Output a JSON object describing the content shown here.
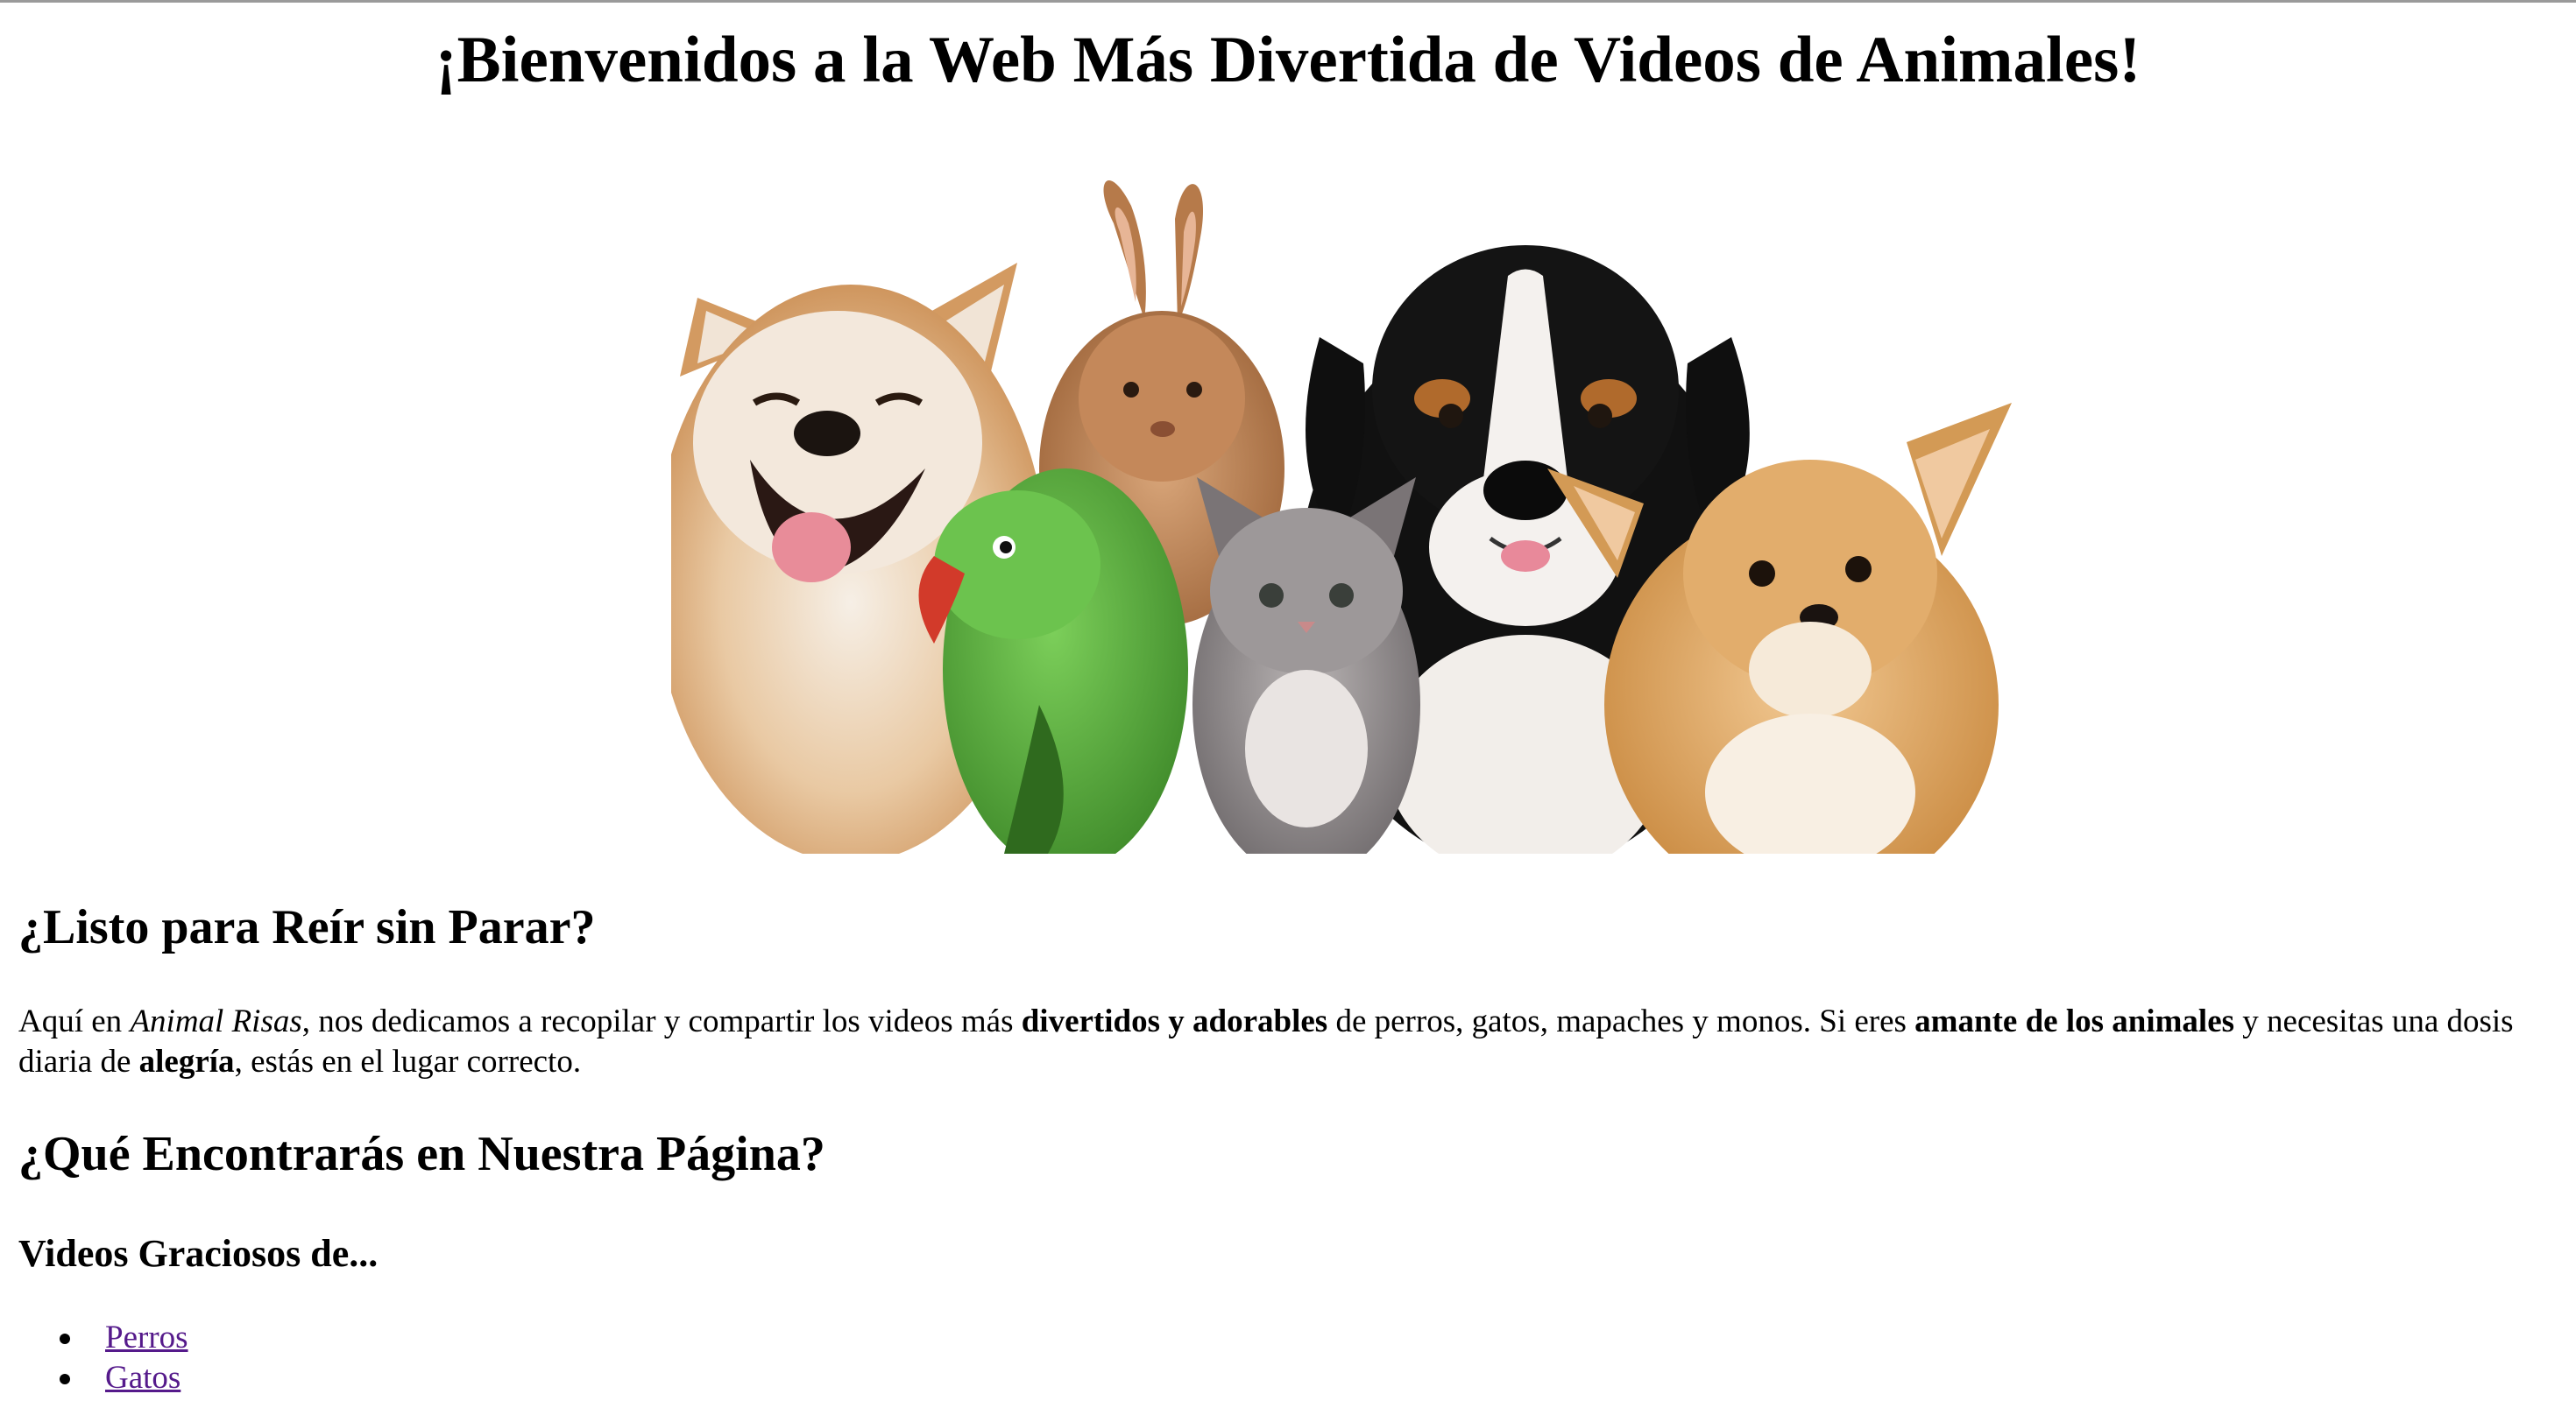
{
  "page": {
    "title": "¡Bienvenidos a la Web Más Divertida de Videos de Animales!"
  },
  "hero": {
    "image_name": "animals-group-photo"
  },
  "intro": {
    "heading": "¿Listo para Reír sin Parar?",
    "text": {
      "t1": "Aquí en ",
      "site_name": "Animal Risas",
      "t2": ", nos dedicamos a recopilar y compartir los videos más ",
      "b1": "divertidos y adorables",
      "t3": " de perros, gatos, mapaches y monos. Si eres ",
      "b2": "amante de los animales",
      "t4": " y necesitas una dosis diaria de ",
      "b3": "alegría",
      "t5": ", estás en el lugar correcto."
    }
  },
  "features": {
    "heading": "¿Qué Encontrarás en Nuestra Página?",
    "videos_heading": "Videos Graciosos de...",
    "links": [
      "Perros",
      "Gatos"
    ]
  },
  "colors": {
    "visited_link": "#551a8b",
    "text": "#000000",
    "background": "#ffffff"
  }
}
